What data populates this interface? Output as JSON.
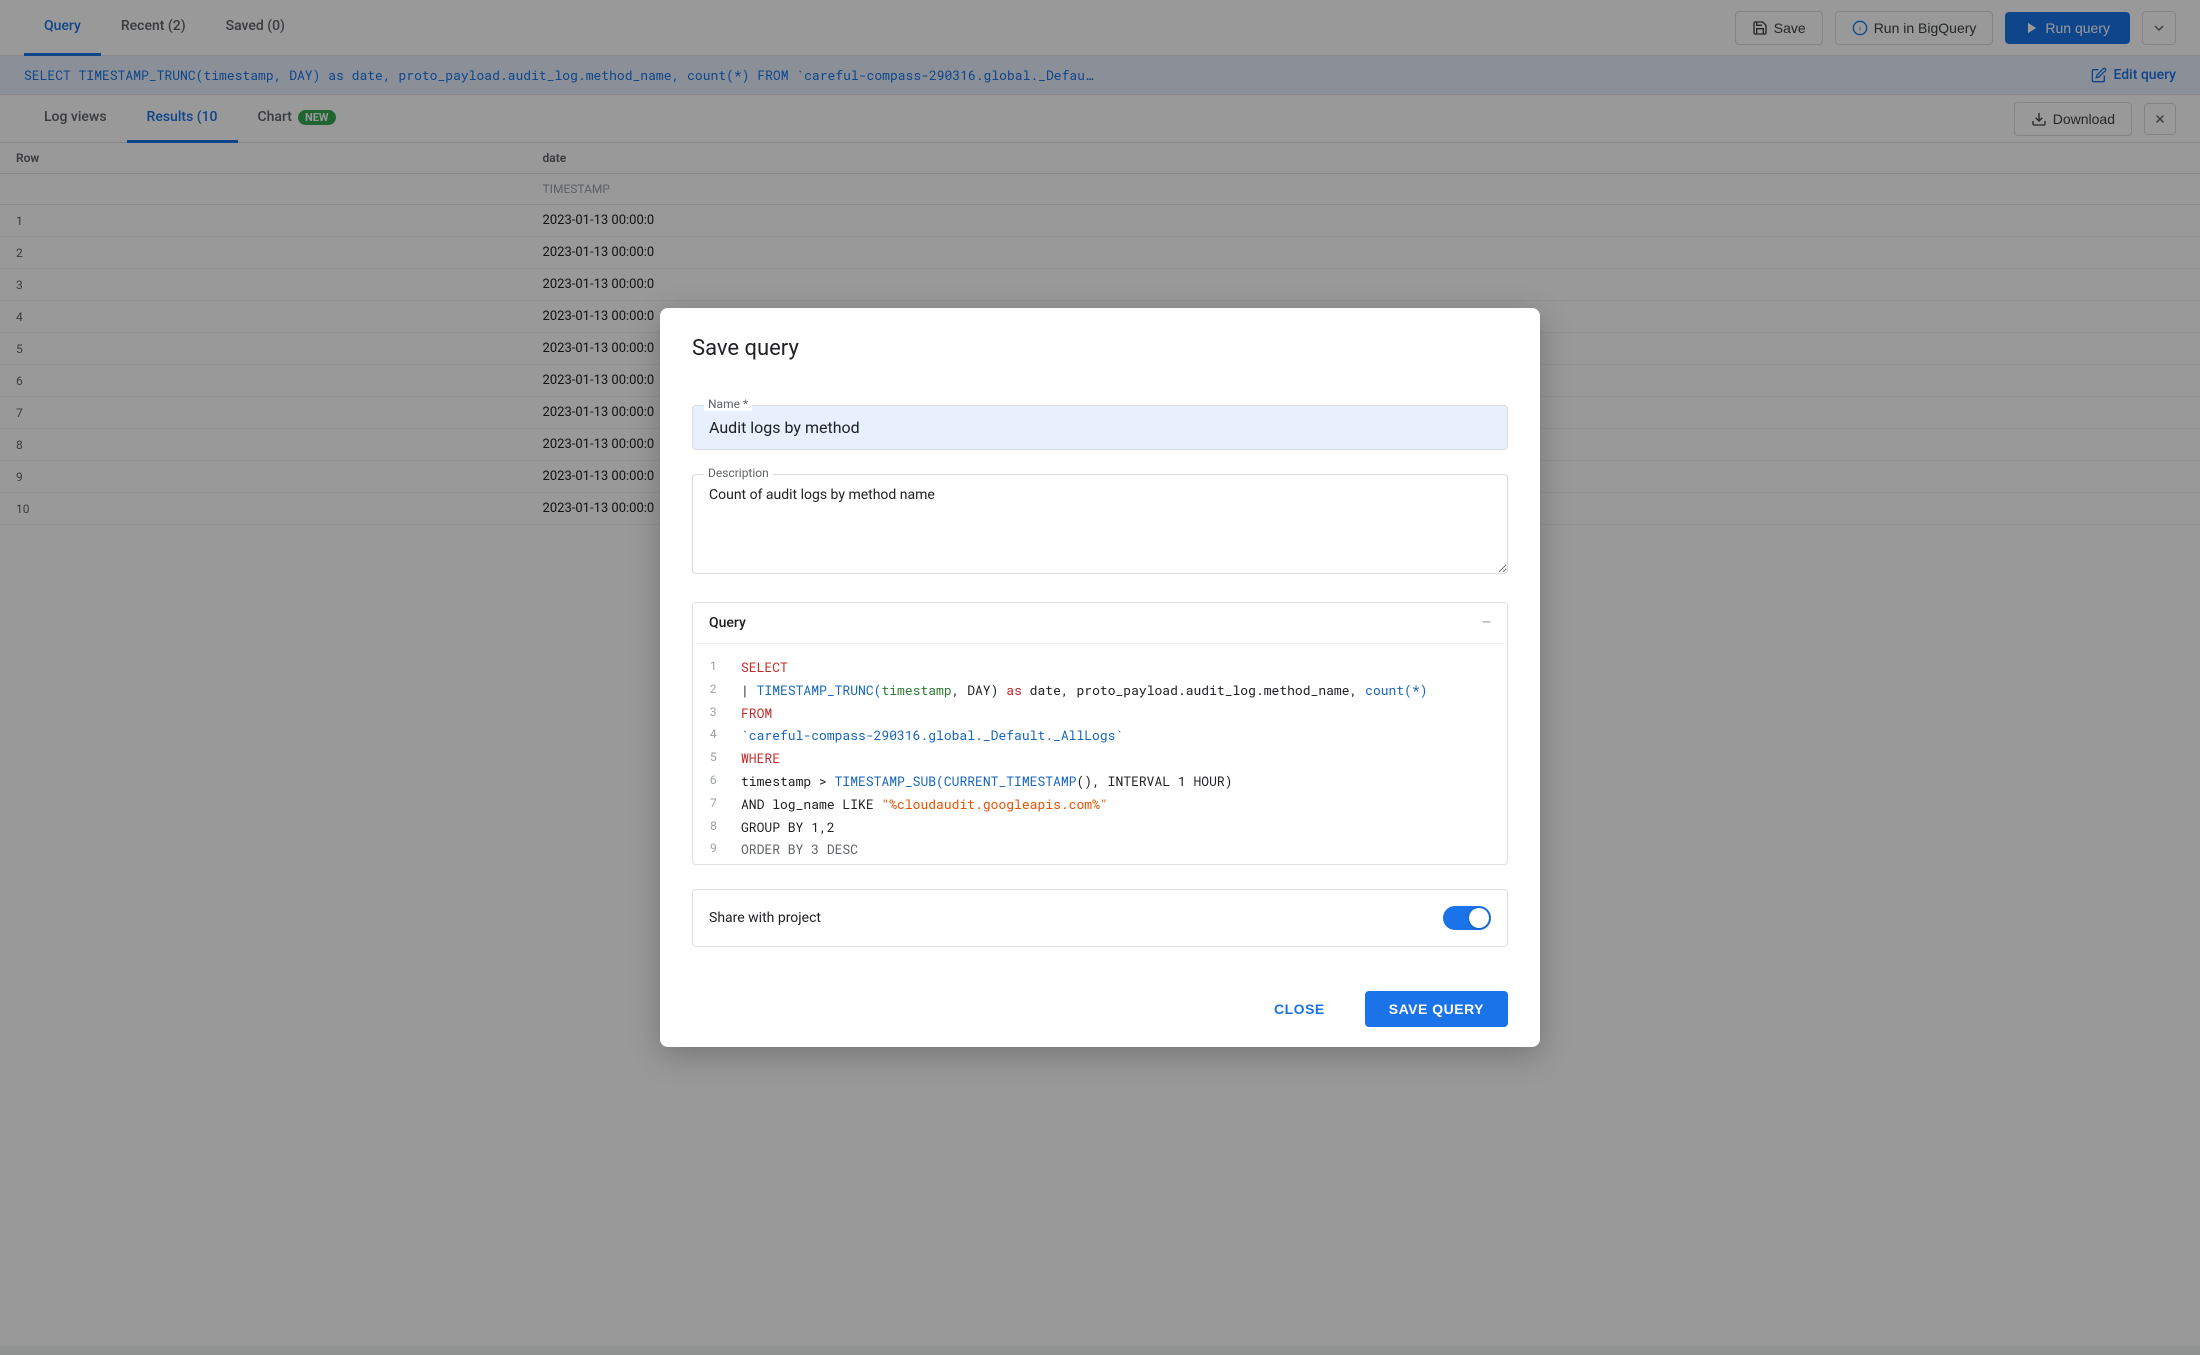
{
  "topNav": {
    "tabs": [
      {
        "label": "Query",
        "active": true
      },
      {
        "label": "Recent (2)",
        "active": false
      },
      {
        "label": "Saved (0)",
        "active": false
      }
    ],
    "saveLabel": "Save",
    "bigqueryLabel": "Run in BigQuery",
    "runLabel": "Run query"
  },
  "sqlBar": {
    "text": "SELECT TIMESTAMP_TRUNC(timestamp, DAY) as date, proto_payload.audit_log.method_name, count(*) FROM `careful-compass-290316.global._Defau…",
    "editLabel": "Edit query"
  },
  "resultsTabs": {
    "tabs": [
      {
        "label": "Log views",
        "active": false
      },
      {
        "label": "Results (10",
        "active": true
      },
      {
        "label": "Chart",
        "active": false,
        "badge": "NEW"
      }
    ],
    "downloadLabel": "Download",
    "closeIcon": "✕"
  },
  "table": {
    "headers": [
      "Row",
      "date",
      ""
    ],
    "subHeaders": [
      "",
      "TIMESTAMP",
      ""
    ],
    "rows": [
      {
        "row": "1",
        "date": "2023-01-13 00:00:0"
      },
      {
        "row": "2",
        "date": "2023-01-13 00:00:0"
      },
      {
        "row": "3",
        "date": "2023-01-13 00:00:0"
      },
      {
        "row": "4",
        "date": "2023-01-13 00:00:0"
      },
      {
        "row": "5",
        "date": "2023-01-13 00:00:0"
      },
      {
        "row": "6",
        "date": "2023-01-13 00:00:0"
      },
      {
        "row": "7",
        "date": "2023-01-13 00:00:0"
      },
      {
        "row": "8",
        "date": "2023-01-13 00:00:0"
      },
      {
        "row": "9",
        "date": "2023-01-13 00:00:0"
      },
      {
        "row": "10",
        "date": "2023-01-13 00:00:0"
      }
    ]
  },
  "modal": {
    "title": "Save query",
    "nameLabel": "Name *",
    "nameValue": "Audit logs by method",
    "descriptionLabel": "Description",
    "descriptionValue": "Count of audit logs by method name",
    "queryLabel": "Query",
    "shareLabel": "Share with project",
    "closeLabel": "CLOSE",
    "saveLabel": "SAVE QUERY",
    "codeLines": [
      {
        "num": "1",
        "tokens": [
          {
            "text": "SELECT",
            "class": "kw"
          }
        ]
      },
      {
        "num": "2",
        "tokens": [
          {
            "text": "  | ",
            "class": ""
          },
          {
            "text": "TIMESTAMP_TRUNC(",
            "class": "fn"
          },
          {
            "text": "timestamp",
            "class": "grn"
          },
          {
            "text": ", DAY) ",
            "class": ""
          },
          {
            "text": "as",
            "class": "kw"
          },
          {
            "text": " date, proto_payload.audit_log.method_name, ",
            "class": ""
          },
          {
            "text": "count(*)",
            "class": "fn"
          }
        ]
      },
      {
        "num": "3",
        "tokens": [
          {
            "text": "FROM",
            "class": "kw"
          }
        ]
      },
      {
        "num": "4",
        "tokens": [
          {
            "text": "  `careful-compass-290316.global._Default._AllLogs`",
            "class": "tbl"
          }
        ]
      },
      {
        "num": "5",
        "tokens": [
          {
            "text": "WHERE",
            "class": "kw"
          }
        ]
      },
      {
        "num": "6",
        "tokens": [
          {
            "text": "  timestamp > ",
            "class": ""
          },
          {
            "text": "TIMESTAMP_SUB(",
            "class": "fn"
          },
          {
            "text": "CURRENT_TIMESTAMP",
            "class": "fn"
          },
          {
            "text": "(), INTERVAL 1 HOUR)",
            "class": ""
          }
        ]
      },
      {
        "num": "7",
        "tokens": [
          {
            "text": "  AND log_name LIKE ",
            "class": ""
          },
          {
            "text": "\"%cloudaudit.googleapis.com%\"",
            "class": "str"
          }
        ]
      },
      {
        "num": "8",
        "tokens": [
          {
            "text": "GROUP BY 1,2",
            "class": ""
          }
        ]
      },
      {
        "num": "9",
        "tokens": [
          {
            "text": "ORDER BY 3 DESC",
            "class": "cmt"
          }
        ]
      }
    ]
  }
}
